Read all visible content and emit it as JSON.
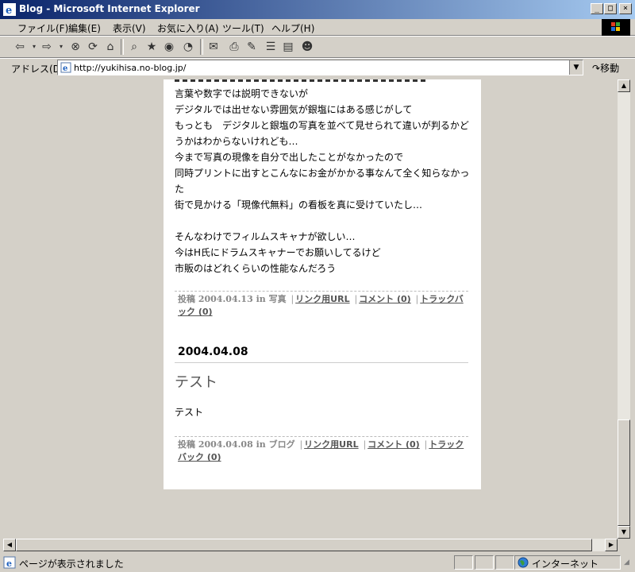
{
  "window": {
    "title": "Blog - Microsoft Internet Explorer"
  },
  "menu": [
    "ファイル(F)",
    "編集(E)",
    "表示(V)",
    "お気に入り(A)",
    "ツール(T)",
    "ヘルプ(H)"
  ],
  "address": {
    "label": "アドレス(D)",
    "url": "http://yukihisa.no-blog.jp/",
    "go_label": "移動"
  },
  "post1": {
    "lines": [
      "言葉や数字では説明できないが",
      "デジタルでは出せない雰囲気が銀塩にはある感じがして",
      "もっとも　デジタルと銀塩の写真を並べて見せられて違いが判るかど",
      "うかはわからないけれども…",
      "今まで写真の現像を自分で出したことがなかったので",
      "同時プリントに出すとこんなにお金がかかる事なんて全く知らなかっ",
      "た",
      "街で見かける「現像代無料」の看板を真に受けていたし…",
      "",
      "そんなわけでフィルムスキャナが欲しい…",
      "今はH氏にドラムスキャナーでお願いしてるけど",
      "市販のはどれくらいの性能なんだろう"
    ],
    "footer": {
      "posted": "投稿",
      "date": "2004.04.13",
      "in": "in",
      "category": "写真",
      "link": "リンク用URL",
      "comments": "コメント (0)",
      "trackback": "トラックバック (0)"
    }
  },
  "post2": {
    "date_header": "2004.04.08",
    "title": "テスト",
    "body": "テスト",
    "footer": {
      "posted": "投稿",
      "date": "2004.04.08",
      "in": "in",
      "category": "ブログ",
      "link": "リンク用URL",
      "comments": "コメント (0)",
      "trackback": "トラックバック (0)"
    }
  },
  "status": {
    "message": "ページが表示されました",
    "zone": "インターネット"
  }
}
